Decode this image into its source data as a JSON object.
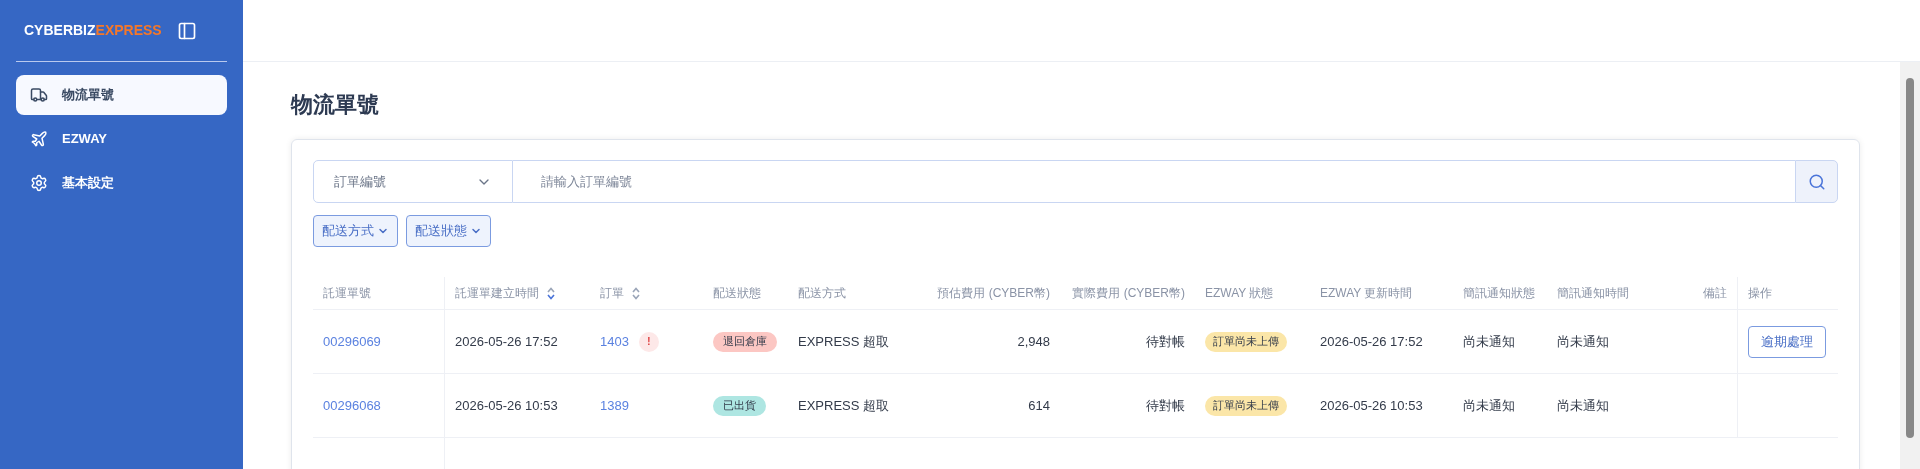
{
  "sidebar": {
    "logo": {
      "brand": "CYBERBIZ",
      "product": "EXPRESS"
    },
    "items": [
      {
        "label": "物流單號",
        "selected": true
      },
      {
        "label": "EZWAY",
        "selected": false
      },
      {
        "label": "基本設定",
        "selected": false
      }
    ]
  },
  "page": {
    "title": "物流單號"
  },
  "search": {
    "field_select": "訂單編號",
    "placeholder": "請輸入訂單編號"
  },
  "filters": [
    "配送方式",
    "配送狀態"
  ],
  "table": {
    "columns": [
      {
        "label": "託運單號"
      },
      {
        "label": "託運單建立時間",
        "sortable": true,
        "sorted": true
      },
      {
        "label": "訂單",
        "sortable": true,
        "sorted": false
      },
      {
        "label": "配送狀態"
      },
      {
        "label": "配送方式"
      },
      {
        "label": "預估費用 (CYBER幣)"
      },
      {
        "label": "實際費用 (CYBER幣)"
      },
      {
        "label": "EZWAY 狀態"
      },
      {
        "label": "EZWAY 更新時間"
      },
      {
        "label": "簡訊通知狀態"
      },
      {
        "label": "簡訊通知時間"
      },
      {
        "label": "備註"
      },
      {
        "label": "操作"
      }
    ],
    "rows": [
      {
        "tracking_no": "00296069",
        "created": "2026-05-26 17:52",
        "order": "1403",
        "order_alert": "!",
        "status": {
          "label": "退回倉庫",
          "color": "#fcc7c3"
        },
        "method": "EXPRESS 超取",
        "estimated_fee": "2,948",
        "actual_fee": "待對帳",
        "ezway_status": "訂單尚未上傳",
        "ezway_updated": "2026-05-26 17:52",
        "sms_status": "尚未通知",
        "sms_time": "尚未通知",
        "action": "逾期處理"
      },
      {
        "tracking_no": "00296068",
        "created": "2026-05-26 10:53",
        "order": "1389",
        "status": {
          "label": "已出貨",
          "color": "#aee6e2"
        },
        "method": "EXPRESS 超取",
        "estimated_fee": "614",
        "actual_fee": "待對帳",
        "ezway_status": "訂單尚未上傳",
        "ezway_updated": "2026-05-26 10:53",
        "sms_status": "尚未通知",
        "sms_time": "尚未通知"
      }
    ]
  }
}
